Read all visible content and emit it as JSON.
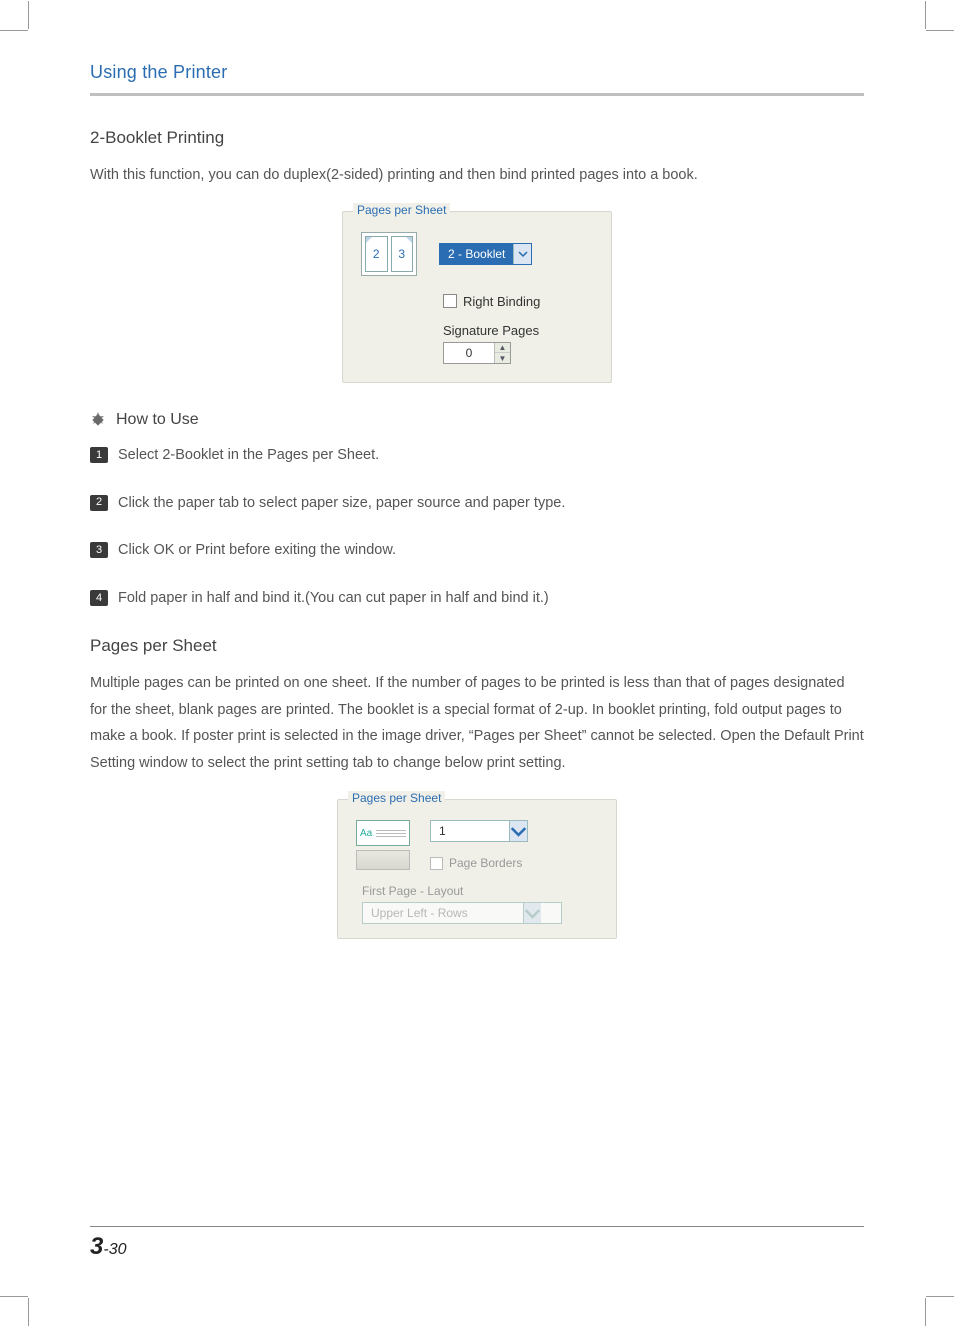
{
  "header": {
    "section": "Using the Printer"
  },
  "booklet": {
    "title": "2-Booklet Printing",
    "intro": "With this function, you can do duplex(2-sided) printing and then bind printed pages into a book."
  },
  "fig1": {
    "legend": "Pages per Sheet",
    "page_left": "2",
    "page_right": "3",
    "combo_label": "2 - Booklet",
    "right_binding": "Right Binding",
    "signature_label": "Signature Pages",
    "signature_value": "0"
  },
  "howto": {
    "title": "How to Use",
    "steps": [
      "Select 2-Booklet in the Pages per Sheet.",
      "Click the paper tab to select paper size, paper source and paper type.",
      "Click OK or Print before exiting the window.",
      "Fold paper in half and bind it.(You can cut paper in half and bind it.)"
    ]
  },
  "pps": {
    "title": "Pages per Sheet",
    "para": "Multiple pages can be printed on one sheet. If the number of pages to be printed is less than that of pages designated for the sheet, blank pages are printed. The booklet is a special format of 2-up. In booklet printing, fold output pages to make a book. If poster print is selected in the image driver, “Pages per Sheet” cannot be selected. Open the Default Print Setting window to select the print setting tab to change below print setting."
  },
  "fig2": {
    "legend": "Pages per Sheet",
    "aa": "Aa",
    "combo_value": "1",
    "page_borders": "Page Borders",
    "first_page_layout_label": "First Page - Layout",
    "first_page_layout_value": "Upper Left - Rows"
  },
  "footer": {
    "chapter": "3",
    "page": "-30"
  }
}
